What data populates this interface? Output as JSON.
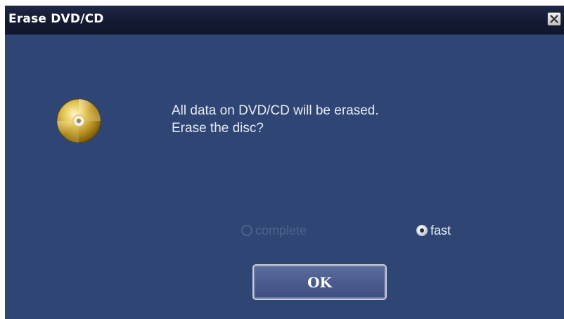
{
  "window": {
    "title": "Erase DVD/CD"
  },
  "message": {
    "line1": "All data on DVD/CD will be erased.",
    "line2": "Erase the disc?"
  },
  "erase_mode": {
    "options": [
      {
        "label": "complete",
        "enabled": false,
        "selected": false
      },
      {
        "label": "fast",
        "enabled": true,
        "selected": true
      }
    ]
  },
  "buttons": {
    "ok_label": "OK"
  },
  "icons": {
    "close": "close-icon",
    "disc": "disc-icon"
  },
  "colors": {
    "dialog_background": "#2f4573",
    "titlebar": "#141a33",
    "disabled_text": "#4f6390"
  }
}
